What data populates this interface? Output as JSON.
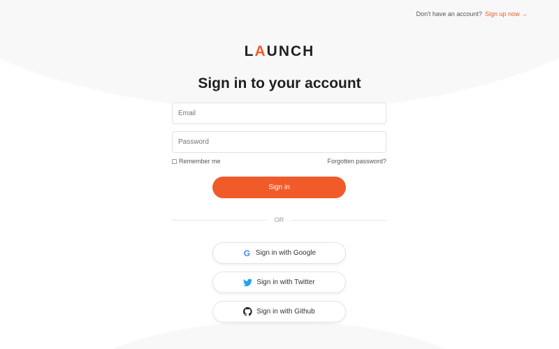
{
  "header": {
    "prompt": "Don't have an account?",
    "signup_link": "Sign up now →"
  },
  "logo": {
    "text_l": "L",
    "text_a": "A",
    "text_rest": "UNCH"
  },
  "title": "Sign in to your account",
  "form": {
    "email_placeholder": "Email",
    "password_placeholder": "Password",
    "remember_label": "Remember me",
    "forgot_link": "Forgotten password?",
    "submit_label": "Sign in"
  },
  "divider": "OR",
  "social": [
    {
      "label": "Sign in with Google",
      "icon": "google-icon"
    },
    {
      "label": "Sign in with Twitter",
      "icon": "twitter-icon"
    },
    {
      "label": "Sign in with Github",
      "icon": "github-icon"
    }
  ],
  "colors": {
    "accent": "#f15a29",
    "twitter": "#1da1f2"
  }
}
